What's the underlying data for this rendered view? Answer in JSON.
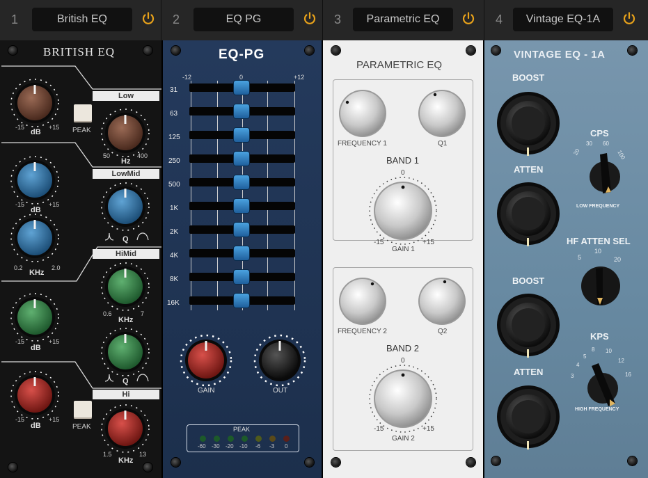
{
  "slots": [
    {
      "number": "1",
      "name": "British EQ"
    },
    {
      "number": "2",
      "name": "EQ PG"
    },
    {
      "number": "3",
      "name": "Parametric EQ"
    },
    {
      "number": "4",
      "name": "Vintage EQ-1A"
    }
  ],
  "colors": {
    "power_icon": "#e8a21a",
    "british_bg": "#141414",
    "eqpg_bg": "#1f3352",
    "parametric_bg": "#eeeeee",
    "vintage_bg": "#6f8fa6"
  },
  "british": {
    "title": "BRITISH EQ",
    "bands": {
      "low": "Low",
      "lowmid": "LowMid",
      "himid": "HiMid",
      "hi": "Hi"
    },
    "peak_label": "PEAK",
    "db": "dB",
    "hz": "Hz",
    "khz": "KHz",
    "q": "Q",
    "scale_m15": "-15",
    "scale_p15": "+15",
    "low_hz_min": "50",
    "low_hz_max": "400",
    "lowmid_khz_min": "0.2",
    "lowmid_khz_max": "2.0",
    "himid_khz_min": "0.6",
    "himid_khz_max": "7",
    "hi_khz_min": "1.5",
    "hi_khz_max": "13"
  },
  "eqpg": {
    "title": "EQ-PG",
    "scale": [
      "-12",
      "0",
      "+12"
    ],
    "bands": [
      "31",
      "63",
      "125",
      "250",
      "500",
      "1K",
      "2K",
      "4K",
      "8K",
      "16K"
    ],
    "gain_label": "GAIN",
    "out_label": "OUT",
    "peak_label": "PEAK",
    "meter_scale": [
      "-60",
      "-30",
      "-20",
      "-10",
      "-6",
      "-3",
      "0"
    ]
  },
  "parametric": {
    "title": "PARAMETRIC EQ",
    "band1": {
      "name": "BAND 1",
      "freq_label": "FREQUENCY 1",
      "q_label": "Q1",
      "gain_label": "GAIN 1",
      "zero": "0",
      "min": "-15",
      "max": "+15"
    },
    "band2": {
      "name": "BAND 2",
      "freq_label": "FREQUENCY 2",
      "q_label": "Q2",
      "gain_label": "GAIN 2",
      "zero": "0",
      "min": "-15",
      "max": "+15"
    }
  },
  "vintage": {
    "title": "VINTAGE EQ - 1A",
    "boost1": "BOOST",
    "atten1": "ATTEN",
    "cps_label": "CPS",
    "cps_scale": [
      "20",
      "30",
      "60",
      "100"
    ],
    "low_freq_label": "LOW FREQUENCY",
    "hf_atten_sel": "HF ATTEN SEL",
    "hf_scale": [
      "5",
      "10",
      "20"
    ],
    "boost2": "BOOST",
    "atten2": "ATTEN",
    "kps_label": "KPS",
    "kps_scale": [
      "3",
      "4",
      "5",
      "8",
      "10",
      "12",
      "16"
    ],
    "high_freq_label": "HIGH FREQUENCY"
  }
}
